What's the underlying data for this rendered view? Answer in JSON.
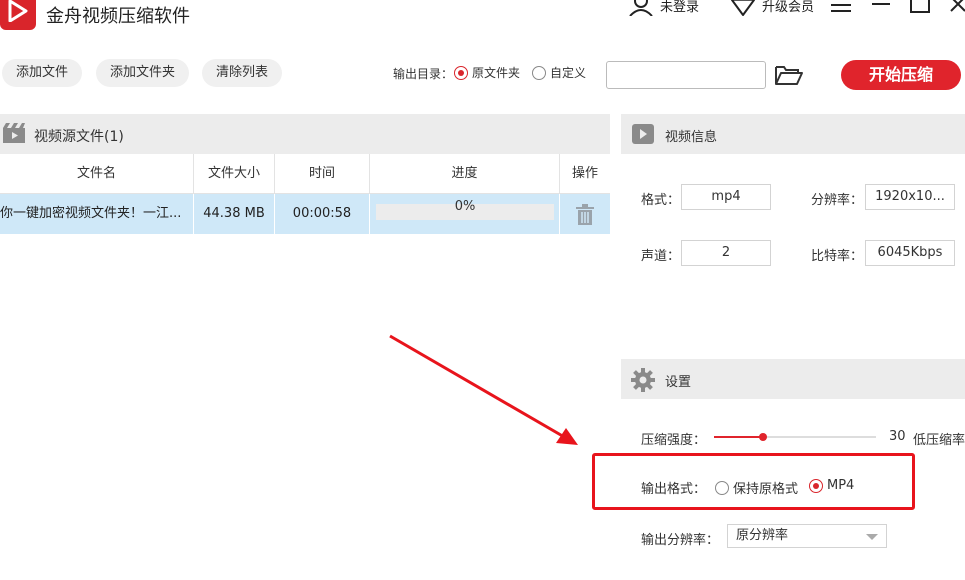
{
  "app": {
    "title": "金舟视频压缩软件"
  },
  "titlebar": {
    "login": "未登录",
    "upgrade": "升级会员"
  },
  "toolbar": {
    "add_file": "添加文件",
    "add_folder": "添加文件夹",
    "clear_list": "清除列表",
    "output_dir_label": "输出目录：",
    "opt_original": "原文件夹",
    "opt_custom": "自定义",
    "output_dir_selected": "原文件夹",
    "path_value": "",
    "start": "开始压缩"
  },
  "source": {
    "title": "视频源文件(1)",
    "columns": [
      "文件名",
      "文件大小",
      "时间",
      "进度",
      "操作"
    ],
    "rows": [
      {
        "name": "你一键加密视频文件夹！一江...",
        "size": "44.38 MB",
        "time": "00:00:58",
        "progress": "0%",
        "progress_value": 0
      }
    ]
  },
  "info": {
    "title": "视频信息",
    "format_label": "格式：",
    "format": "mp4",
    "resolution_label": "分辨率：",
    "resolution": "1920x10...",
    "channels_label": "声道：",
    "channels": "2",
    "bitrate_label": "比特率：",
    "bitrate": "6045Kbps"
  },
  "settings": {
    "title": "设置",
    "strength_label": "压缩强度：",
    "strength_value": "30",
    "strength_percent": 30,
    "strength_desc": "低压缩率",
    "format_label": "输出格式：",
    "format_keep": "保持原格式",
    "format_mp4": "MP4",
    "format_selected": "MP4",
    "resolution_label": "输出分辨率：",
    "resolution_value": "原分辨率"
  },
  "colors": {
    "accent": "#e0242c",
    "row_selected": "#cfe8f8",
    "panel_header": "#ececec"
  }
}
